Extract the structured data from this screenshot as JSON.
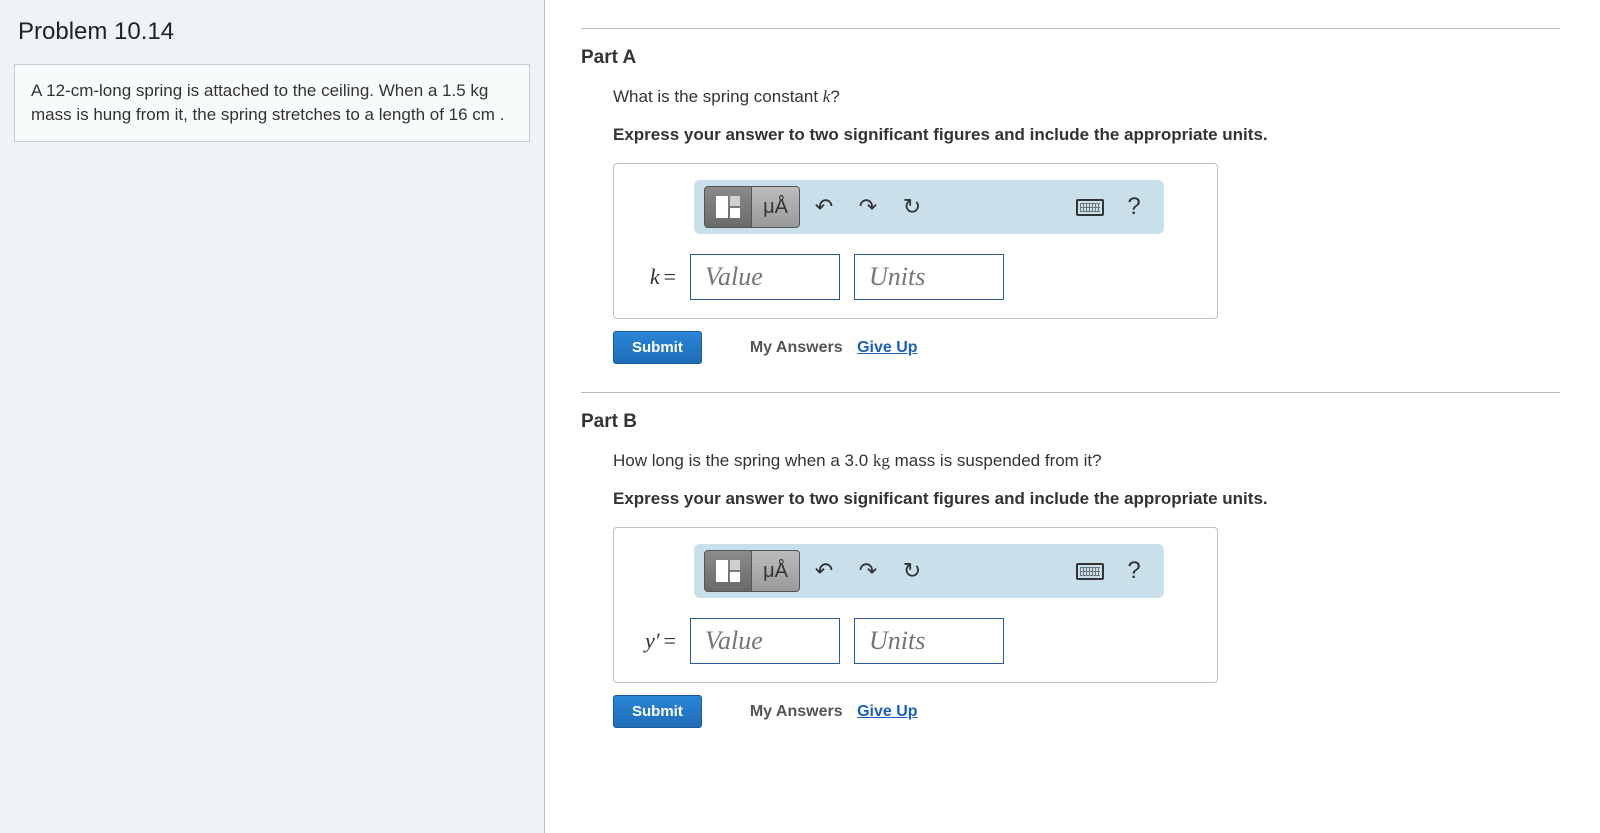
{
  "problem": {
    "title": "Problem 10.14",
    "statement_html": "A 12-cm-long spring is attached to the ceiling. When a 1.5 kg mass is hung from it, the spring stretches to a length of 16 cm ."
  },
  "parts": [
    {
      "label": "Part A",
      "question": "What is the spring constant k?",
      "question_var": "k",
      "instruction": "Express your answer to two significant figures and include the appropriate units.",
      "eq_label": "k",
      "eq_sign": "=",
      "value_placeholder": "Value",
      "units_placeholder": "Units",
      "toolbar": {
        "units_label": "μÅ"
      },
      "submit_label": "Submit",
      "my_answers_label": "My Answers",
      "give_up_label": "Give Up"
    },
    {
      "label": "Part B",
      "question": "How long is the spring when a 3.0 kg mass is suspended from it?",
      "question_var": "",
      "instruction": "Express your answer to two significant figures and include the appropriate units.",
      "eq_label": "y′",
      "eq_sign": "=",
      "value_placeholder": "Value",
      "units_placeholder": "Units",
      "toolbar": {
        "units_label": "μÅ"
      },
      "submit_label": "Submit",
      "my_answers_label": "My Answers",
      "give_up_label": "Give Up"
    }
  ],
  "icons": {
    "undo": "↶",
    "redo": "↷",
    "reset": "↻",
    "help": "?"
  }
}
